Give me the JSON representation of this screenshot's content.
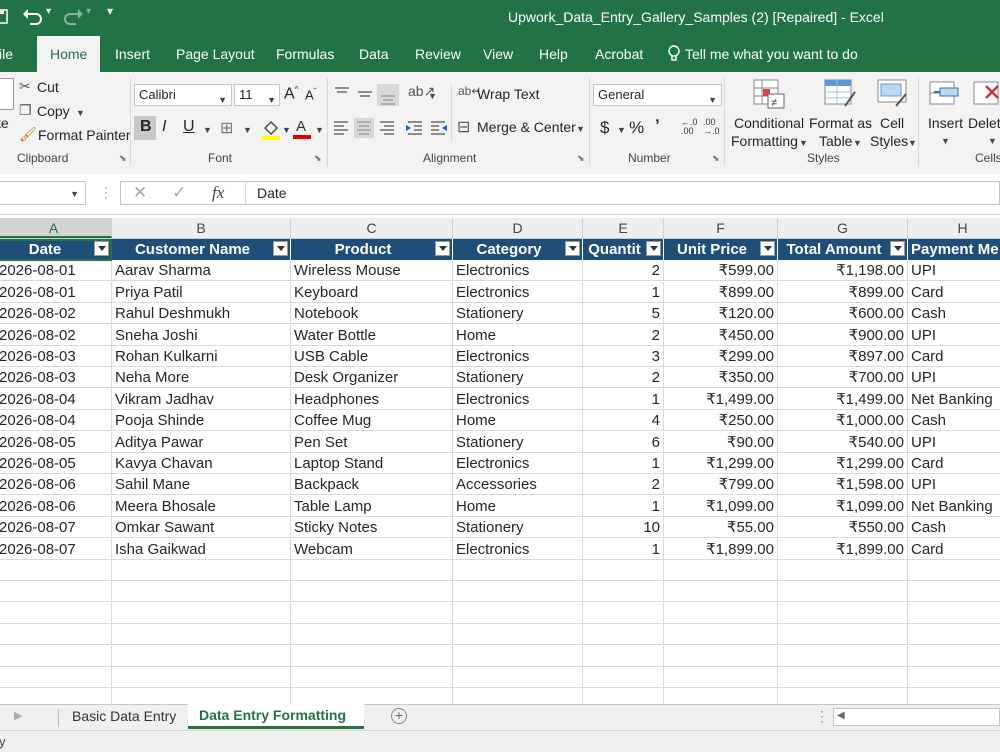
{
  "window": {
    "title": "Upwork_Data_Entry_Gallery_Samples (2) [Repaired]  -  Excel"
  },
  "tabs": [
    "ile",
    "Home",
    "Insert",
    "Page Layout",
    "Formulas",
    "Data",
    "Review",
    "View",
    "Help",
    "Acrobat"
  ],
  "tell_me": "Tell me what you want to do",
  "ribbon": {
    "clipboard": {
      "paste": "te",
      "cut": "Cut",
      "copy": "Copy",
      "format_painter": "Format Painter",
      "label": "Clipboard"
    },
    "font": {
      "name": "Calibri",
      "size": "11",
      "bold": "B",
      "italic": "I",
      "underline": "U",
      "label": "Font"
    },
    "alignment": {
      "wrap_text": "Wrap Text",
      "merge_center": "Merge & Center",
      "label": "Alignment"
    },
    "number": {
      "format": "General",
      "currency": "$",
      "percent": "%",
      "comma": "ʼ",
      "label": "Number"
    },
    "styles": {
      "conditional_1": "Conditional",
      "conditional_2": "Formatting",
      "format_as_1": "Format as",
      "format_as_2": "Table",
      "cell_1": "Cell",
      "cell_2": "Styles",
      "label": "Styles"
    },
    "cells": {
      "insert": "Insert",
      "delete": "Delete",
      "label": "Cells"
    }
  },
  "formula_bar": {
    "fx": "fx",
    "value": "Date"
  },
  "columns": [
    "A",
    "B",
    "C",
    "D",
    "E",
    "F",
    "G",
    "H"
  ],
  "table": {
    "headers": [
      "Date",
      "Customer Name",
      "Product",
      "Category",
      "Quantit",
      "Unit Price",
      "Total Amount",
      "Payment Me"
    ],
    "rows": [
      [
        "2026-08-01",
        "Aarav Sharma",
        "Wireless Mouse",
        "Electronics",
        "2",
        "₹599.00",
        "₹1,198.00",
        "UPI"
      ],
      [
        "2026-08-01",
        "Priya Patil",
        "Keyboard",
        "Electronics",
        "1",
        "₹899.00",
        "₹899.00",
        "Card"
      ],
      [
        "2026-08-02",
        "Rahul Deshmukh",
        "Notebook",
        "Stationery",
        "5",
        "₹120.00",
        "₹600.00",
        "Cash"
      ],
      [
        "2026-08-02",
        "Sneha Joshi",
        "Water Bottle",
        "Home",
        "2",
        "₹450.00",
        "₹900.00",
        "UPI"
      ],
      [
        "2026-08-03",
        "Rohan Kulkarni",
        "USB Cable",
        "Electronics",
        "3",
        "₹299.00",
        "₹897.00",
        "Card"
      ],
      [
        "2026-08-03",
        "Neha More",
        "Desk Organizer",
        "Stationery",
        "2",
        "₹350.00",
        "₹700.00",
        "UPI"
      ],
      [
        "2026-08-04",
        "Vikram Jadhav",
        "Headphones",
        "Electronics",
        "1",
        "₹1,499.00",
        "₹1,499.00",
        "Net Banking"
      ],
      [
        "2026-08-04",
        "Pooja Shinde",
        "Coffee Mug",
        "Home",
        "4",
        "₹250.00",
        "₹1,000.00",
        "Cash"
      ],
      [
        "2026-08-05",
        "Aditya Pawar",
        "Pen Set",
        "Stationery",
        "6",
        "₹90.00",
        "₹540.00",
        "UPI"
      ],
      [
        "2026-08-05",
        "Kavya Chavan",
        "Laptop Stand",
        "Electronics",
        "1",
        "₹1,299.00",
        "₹1,299.00",
        "Card"
      ],
      [
        "2026-08-06",
        "Sahil Mane",
        "Backpack",
        "Accessories",
        "2",
        "₹799.00",
        "₹1,598.00",
        "UPI"
      ],
      [
        "2026-08-06",
        "Meera Bhosale",
        "Table Lamp",
        "Home",
        "1",
        "₹1,099.00",
        "₹1,099.00",
        "Net Banking"
      ],
      [
        "2026-08-07",
        "Omkar Sawant",
        "Sticky Notes",
        "Stationery",
        "10",
        "₹55.00",
        "₹550.00",
        "Cash"
      ],
      [
        "2026-08-07",
        "Isha Gaikwad",
        "Webcam",
        "Electronics",
        "1",
        "₹1,899.00",
        "₹1,899.00",
        "Card"
      ]
    ]
  },
  "sheets": {
    "basic": "Basic Data Entry",
    "active": "Data Entry Formatting"
  },
  "status": {
    "text": "y"
  },
  "colors": {
    "excel_green": "#217346",
    "header_fill": "#1f4e79"
  }
}
